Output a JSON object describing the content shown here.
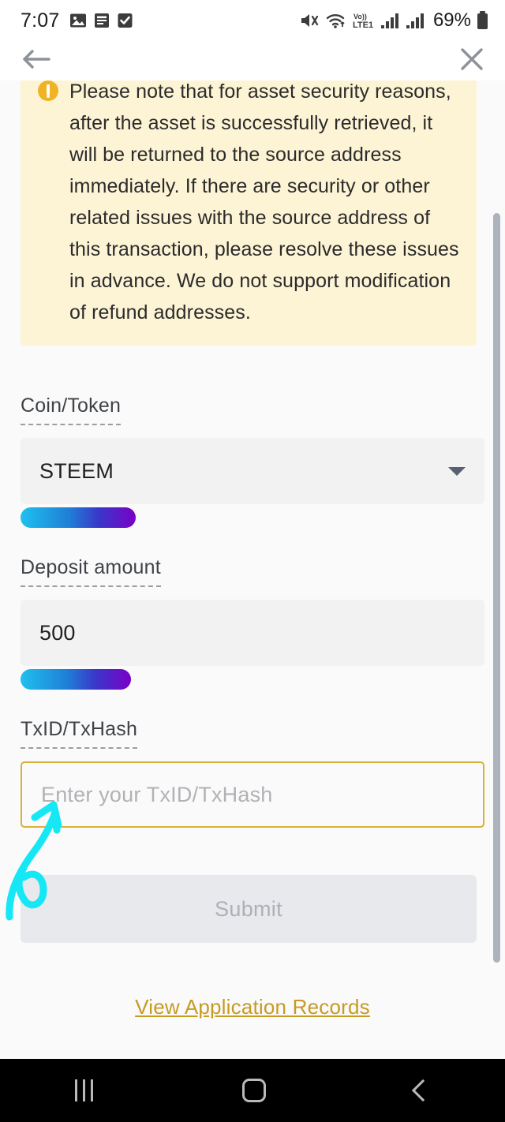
{
  "status_bar": {
    "time": "7:07",
    "battery_percent": "69%",
    "left_icons": [
      "image-icon",
      "article-icon",
      "checkbox-icon"
    ],
    "right_icons": [
      "mute-icon",
      "wifi-icon",
      "volte-icon",
      "signal-sim1-icon",
      "signal-sim2-icon",
      "battery-icon"
    ]
  },
  "header": {
    "back_icon": "back-arrow-icon",
    "close_icon": "close-icon"
  },
  "notice": {
    "icon": "warning-circle-icon",
    "text": "Please note that for asset security reasons, after the asset is successfully retrieved, it will be returned to the source address immediately. If there are security or other related issues with the source address of this transaction, please resolve these issues in advance. We do not support modification of refund addresses."
  },
  "form": {
    "coin": {
      "label": "Coin/Token",
      "value": "STEEM",
      "caret_icon": "chevron-down-icon"
    },
    "amount": {
      "label": "Deposit amount",
      "value": "500"
    },
    "txid": {
      "label": "TxID/TxHash",
      "value": "",
      "placeholder": "Enter your TxID/TxHash"
    },
    "submit_label": "Submit",
    "records_link": "View Application Records"
  },
  "colors": {
    "notice_bg": "#fdf3d5",
    "notice_accent": "#f0b323",
    "txid_border": "#d8b13a",
    "link": "#c79a21",
    "submit_bg": "#e8e9ec",
    "submit_text": "#aeb0b8",
    "gradient_start": "#1fc1ef",
    "gradient_end": "#7a00c8",
    "annotation": "#16e7f5"
  },
  "navbar": {
    "recents_icon": "recents-icon",
    "home_icon": "home-icon",
    "back_icon": "nav-back-icon"
  }
}
